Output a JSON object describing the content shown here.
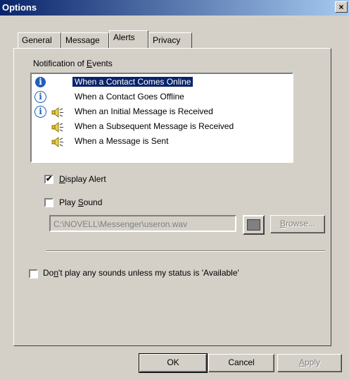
{
  "window": {
    "title": "Options",
    "close_label": "×"
  },
  "tabs": [
    {
      "label": "General",
      "active": false
    },
    {
      "label": "Message",
      "active": false
    },
    {
      "label": "Alerts",
      "active": true
    },
    {
      "label": "Privacy",
      "active": false
    }
  ],
  "notification": {
    "group_label_pre": "Notification of ",
    "group_label_key": "E",
    "group_label_post": "vents",
    "events": [
      {
        "label": "When a Contact Comes Online",
        "alert": true,
        "sound": false,
        "selected": true
      },
      {
        "label": "When a Contact Goes Offline",
        "alert": true,
        "sound": false,
        "selected": false
      },
      {
        "label": "When an Initial Message is Received",
        "alert": true,
        "sound": true,
        "selected": false
      },
      {
        "label": "When a Subsequent Message is Received",
        "alert": false,
        "sound": true,
        "selected": false
      },
      {
        "label": "When a Message is Sent",
        "alert": false,
        "sound": true,
        "selected": false
      }
    ]
  },
  "display_alert": {
    "key": "D",
    "rest": "isplay Alert",
    "checked": true,
    "check_glyph": "✔"
  },
  "play_sound": {
    "pre": "Play ",
    "key": "S",
    "rest": "ound",
    "checked": false
  },
  "sound_path": "C:\\NOVELL\\Messenger\\useron.wav",
  "browse": {
    "key": "B",
    "rest": "rowse..."
  },
  "available_only": {
    "pre": "Do",
    "key": "n",
    "rest": "'t play any sounds unless my status is 'Available'",
    "checked": false
  },
  "buttons": {
    "ok": "OK",
    "cancel": "Cancel",
    "apply_key": "A",
    "apply_rest": "pply"
  }
}
